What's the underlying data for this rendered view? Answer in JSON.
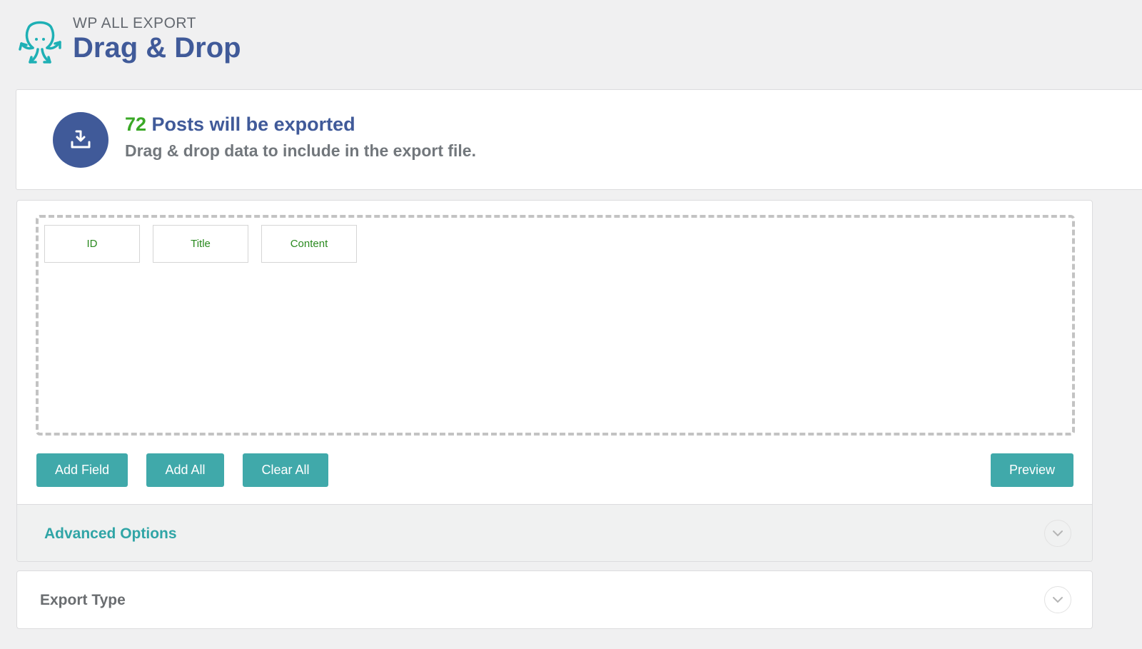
{
  "header": {
    "brand": "WP ALL EXPORT",
    "title": "Drag & Drop",
    "logo_icon": "octopus-logo-icon"
  },
  "notice": {
    "icon": "download-icon",
    "count": "72",
    "count_suffix": " Posts will be exported",
    "subtitle": "Drag & drop data to include in the export file."
  },
  "dropzone": {
    "fields": [
      {
        "label": "ID"
      },
      {
        "label": "Title"
      },
      {
        "label": "Content"
      }
    ]
  },
  "buttons": {
    "add_field": "Add Field",
    "add_all": "Add All",
    "clear_all": "Clear All",
    "preview": "Preview"
  },
  "sections": {
    "advanced_options": "Advanced Options",
    "export_type": "Export Type"
  },
  "colors": {
    "accent": "#40a9aa",
    "brand_blue": "#405a99",
    "count_green": "#3aa826",
    "field_green": "#2a8a1f"
  }
}
